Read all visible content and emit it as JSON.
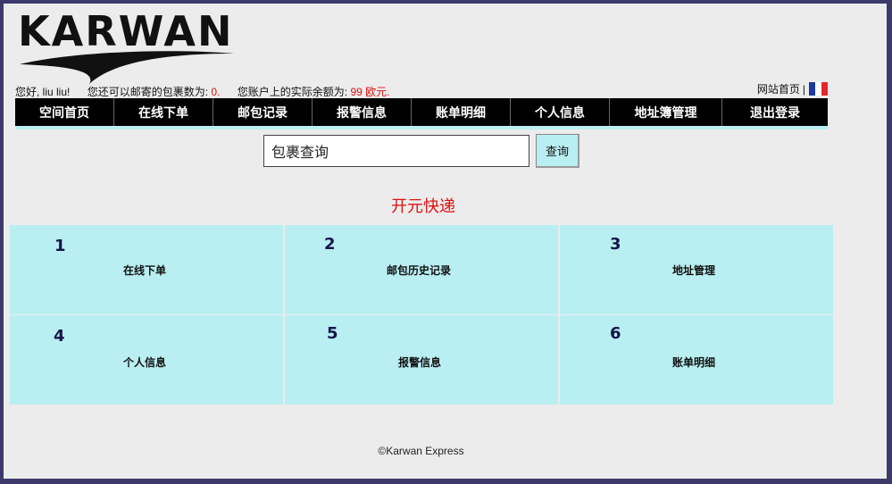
{
  "logo": {
    "text": "KARWAN"
  },
  "greeting": {
    "hello": "您好, liu liu!",
    "parcels_label": "您还可以邮寄的包裹数为:",
    "parcels_value": "0.",
    "balance_label": "您账户上的实际余额为:",
    "balance_value": "99 欧元."
  },
  "top_links": {
    "home": "网站首页",
    "separator": "|",
    "language_icon": "france-flag-icon"
  },
  "nav": [
    {
      "label": "空间首页"
    },
    {
      "label": "在线下单"
    },
    {
      "label": "邮包记录"
    },
    {
      "label": "报警信息"
    },
    {
      "label": "账单明细"
    },
    {
      "label": "个人信息"
    },
    {
      "label": "地址簿管理"
    },
    {
      "label": "退出登录"
    }
  ],
  "search": {
    "value": "包裹查询",
    "button_label": "查询"
  },
  "section_title": "开元快递",
  "tiles": [
    {
      "number": "1",
      "label": "在线下单"
    },
    {
      "number": "2",
      "label": "邮包历史记录"
    },
    {
      "number": "3",
      "label": "地址管理"
    },
    {
      "number": "4",
      "label": "个人信息"
    },
    {
      "number": "5",
      "label": "报警信息"
    },
    {
      "number": "6",
      "label": "账单明细"
    }
  ],
  "footer": "©Karwan Express",
  "colors": {
    "border": "#3d3a6b",
    "background": "#ececec",
    "tile": "#b9eef2",
    "accent_red": "#e01010",
    "nav": "#000000"
  }
}
